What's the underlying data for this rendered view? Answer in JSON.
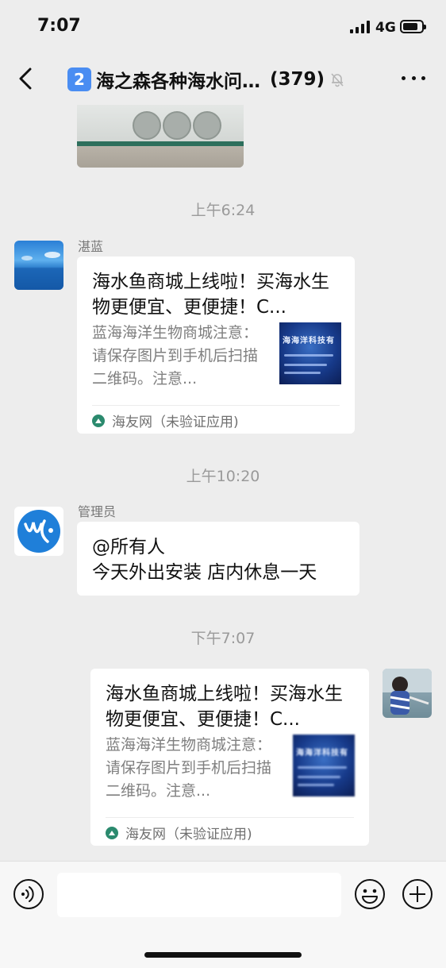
{
  "status_bar": {
    "time": "7:07",
    "network": "4G"
  },
  "header": {
    "badge": "2",
    "title": "海之森各种海水问…",
    "count": "(379)",
    "icons": [
      "back-icon",
      "mute-bell-icon",
      "more-icon"
    ]
  },
  "messages": [
    {
      "type": "timestamp",
      "text": "上午6:24"
    },
    {
      "type": "link_card",
      "side": "left",
      "sender": "湛蓝",
      "title": "海水鱼商城上线啦！买海水生物更便宜、更便捷！C...",
      "desc": "蓝海海洋生物商城注意：请保存图片到手机后扫描二维码。注意...",
      "thumb_text": "海海洋科技有",
      "source": "海友网（未验证应用)"
    },
    {
      "type": "timestamp",
      "text": "上午10:20"
    },
    {
      "type": "text",
      "side": "left",
      "sender": "管理员",
      "lines": [
        "@所有人",
        "今天外出安装 店内休息一天"
      ]
    },
    {
      "type": "timestamp",
      "text": "下午7:07"
    },
    {
      "type": "link_card",
      "side": "right",
      "title": "海水鱼商城上线啦！买海水生物更便宜、更便捷！C...",
      "desc": "蓝海海洋生物商城注意：请保存图片到手机后扫描二维码。注意...",
      "thumb_text": "海海洋科技有",
      "source": "海友网（未验证应用)"
    }
  ],
  "input_bar": {
    "icons": [
      "voice-icon",
      "emoji-icon",
      "plus-icon"
    ]
  },
  "colors": {
    "background": "#ededed",
    "bubble": "#ffffff",
    "timestamp": "#9a9a9a",
    "badge": "#4a8df2"
  }
}
